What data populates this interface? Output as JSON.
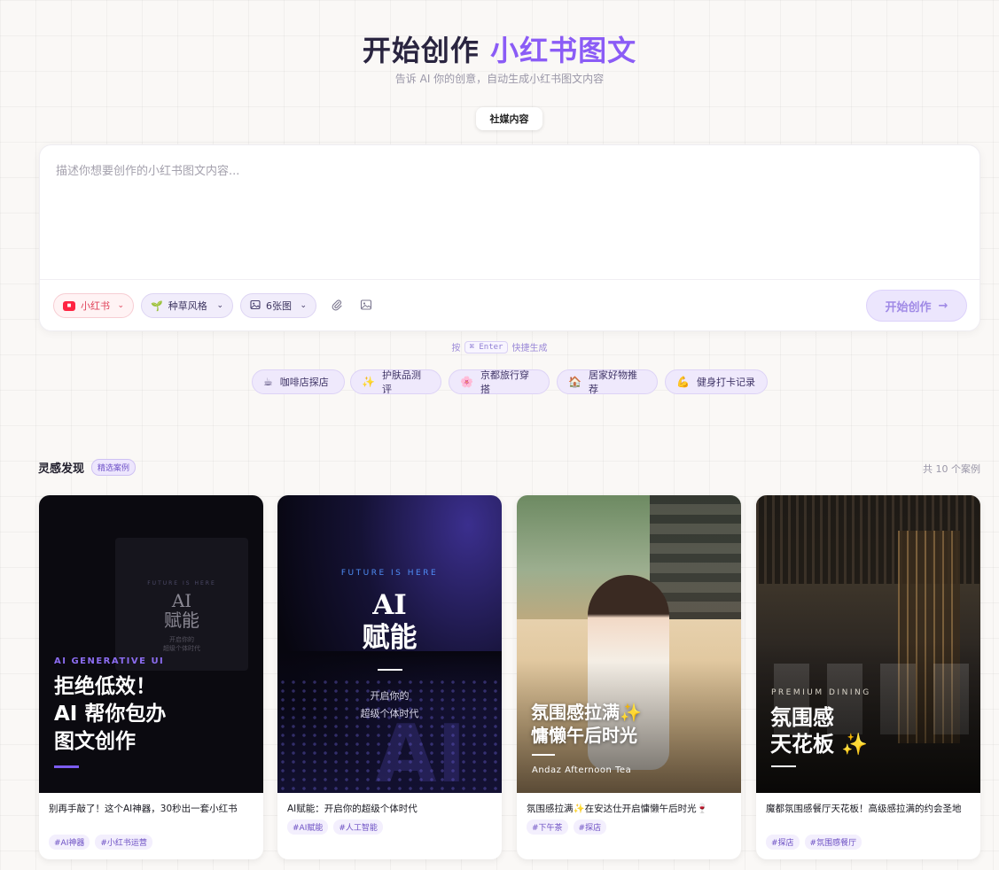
{
  "hero": {
    "title_main": "开始创作 ",
    "title_accent": "小红书图文",
    "subtitle": "告诉 AI 你的创意，自动生成小红书图文内容",
    "mode_tab": "社媒内容"
  },
  "composer": {
    "placeholder": "描述你想要创作的小红书图文内容...",
    "platform_label": "小红书",
    "style_label": "种草风格",
    "count_label": "6张图",
    "start_button": "开始创作",
    "hint_prefix": "按",
    "hint_key": "⌘ Enter",
    "hint_suffix": "快捷生成"
  },
  "quick_chips": [
    {
      "emoji": "☕",
      "label": "咖啡店探店"
    },
    {
      "emoji": "✨",
      "label": "护肤品测评"
    },
    {
      "emoji": "🌸",
      "label": "京都旅行穿搭"
    },
    {
      "emoji": "🏠",
      "label": "居家好物推荐"
    },
    {
      "emoji": "💪",
      "label": "健身打卡记录"
    }
  ],
  "inspiration": {
    "title": "灵感发现",
    "badge": "精选案例",
    "count_text": "共 10 个案例"
  },
  "cards": [
    {
      "cover": {
        "mini_en": "FUTURE IS HERE",
        "mini_ai": "AI",
        "mini_ai2": "赋能",
        "mini_sub": "开启你的",
        "mini_sub2": "超级个体时代",
        "label": "AI GENERATIVE UI",
        "line1": "拒绝低效！",
        "line2": "AI 帮你包办",
        "line3": "图文创作"
      },
      "title": "别再手敲了！这个AI神器，30秒出一套小红书",
      "tags": [
        "#AI神器",
        "#小红书运营"
      ]
    },
    {
      "cover": {
        "en": "FUTURE IS HERE",
        "ai": "AI",
        "ai2": "赋能",
        "sub1": "开启你的",
        "sub2": "超级个体时代",
        "ghost": "AI"
      },
      "title": "AI赋能：开启你的超级个体时代",
      "tags": [
        "#AI赋能",
        "#人工智能"
      ]
    },
    {
      "cover": {
        "line1": "氛围感拉满✨",
        "line2": "慵懒午后时光",
        "en": "Andaz Afternoon Tea"
      },
      "title": "氛围感拉满✨在安达仕开启慵懒午后时光🍷",
      "tags": [
        "#下午茶",
        "#探店"
      ]
    },
    {
      "cover": {
        "en": "PREMIUM DINING",
        "line1": "氛围感",
        "line2": "天花板 ✨"
      },
      "title": "魔都氛围感餐厅天花板！高级感拉满的约会圣地",
      "tags": [
        "#探店",
        "#氛围感餐厅"
      ]
    }
  ]
}
